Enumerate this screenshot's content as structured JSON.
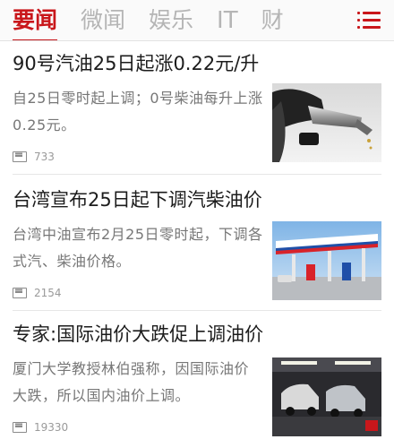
{
  "tabs": [
    {
      "label": "要闻",
      "active": true
    },
    {
      "label": "微闻",
      "active": false
    },
    {
      "label": "娱乐",
      "active": false
    },
    {
      "label": "IT",
      "active": false
    },
    {
      "label": "财",
      "active": false
    }
  ],
  "menu_icon": "menu-icon",
  "accent_color": "#c9171b",
  "news": [
    {
      "title": "90号汽油25日起涨0.22元/升",
      "summary": "自25日零时起上调；0号柴油每升上涨0.25元。",
      "comment_count": "733",
      "image": "fuel-nozzle"
    },
    {
      "title": "台湾宣布25日起下调汽柴油价",
      "summary": "台湾中油宣布2月25日零时起，下调各式汽、柴油价格。",
      "comment_count": "2154",
      "image": "gas-station"
    },
    {
      "title": "专家:国际油价大跌促上调油价",
      "summary": "厦门大学教授林伯强称，因国际油价大跌，所以国内油价上调。",
      "comment_count": "19330",
      "image": "cars-refueling-night"
    }
  ]
}
